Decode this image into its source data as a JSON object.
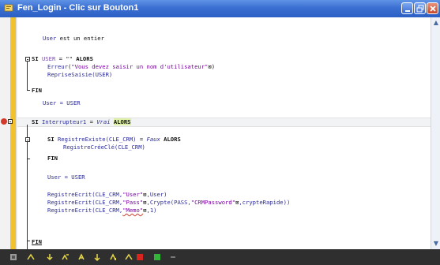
{
  "window": {
    "title": "Fen_Login - Clic sur Bouton1"
  },
  "code": {
    "line1": [
      "User",
      " est un entier"
    ],
    "line2_si": "SI ",
    "line2_user": "USER",
    "line2_rest": " = \"\" ",
    "line2_alors": "ALORS",
    "line3_fn": "Erreur",
    "line3_str": "\"Vous devez saisir un nom d'utilisateur\"",
    "line3_end": ")",
    "line4": "RepriseSaisie(USER)",
    "line5": "FIN",
    "line6": "User = USER",
    "line7_si": "SI ",
    "line7_var": "Interrupteur1",
    "line7_eq": " = ",
    "line7_vrai": "Vrai",
    "line7_alors": "ALORS",
    "line8_si": "SI ",
    "line8_fn": "RegistreExiste(CLE_CRM)",
    "line8_eq": " = ",
    "line8_faux": "Faux",
    "line8_alors": " ALORS",
    "line9": "RegistreCréeClé(CLE_CRM)",
    "line10": "FIN",
    "line11": "User = USER",
    "line12_a": "RegistreEcrit(CLE_CRM,",
    "line12_str": "\"User\"",
    "line12_b": ",User)",
    "line13_a": "RegistreEcrit(CLE_CRM,",
    "line13_str": "\"Pass\"",
    "line13_b": ",Crypte(PASS,",
    "line13_str2": "\"CRMPassword\"",
    "line13_c": ",crypteRapide))",
    "line14_a": "RegistreEcrit(CLE_CRM,",
    "line14_str": "\"Memo\"",
    "line14_b": ",1)",
    "line15": "FIN"
  },
  "colors": {
    "titlebar": "#3b6fd1",
    "gutter_strip": "#f2c12e",
    "breakpoint": "#d23b2c",
    "string": "#7a00a0"
  },
  "statusbar_icons": [
    "run-icon",
    "step-icon",
    "step-into-icon",
    "step-over-icon",
    "step-out-icon",
    "run-to-icon",
    "continue-icon",
    "stop-icon",
    "record-icon"
  ]
}
